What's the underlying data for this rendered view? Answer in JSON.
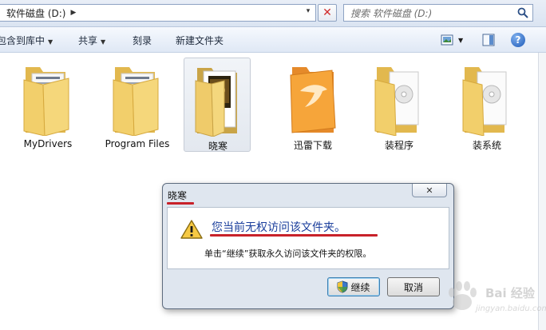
{
  "address_bar": {
    "path_label": "软件磁盘 (D:)",
    "separator": "▶",
    "dropdown_glyph": "▾",
    "stop_glyph": "✕",
    "search_placeholder": "搜索 软件磁盘 (D:)"
  },
  "command_bar": {
    "include_library_label": "包含到库中",
    "share_label": "共享",
    "burn_label": "刻录",
    "new_folder_label": "新建文件夹",
    "help_glyph": "?"
  },
  "files": [
    {
      "label": "MyDrivers",
      "icon": "folder-documents-icon"
    },
    {
      "label": "Program Files",
      "icon": "folder-documents-icon"
    },
    {
      "label": "晓寒",
      "icon": "folder-media-icon",
      "selected": true
    },
    {
      "label": "迅雷下载",
      "icon": "folder-thunder-icon"
    },
    {
      "label": "装程序",
      "icon": "folder-disc-icon"
    },
    {
      "label": "装系统",
      "icon": "folder-disc-icon"
    }
  ],
  "dialog": {
    "title": "晓寒",
    "close_glyph": "✕",
    "message": "您当前无权访问该文件夹。",
    "detail": "单击“继续”获取永久访问该文件夹的权限。",
    "continue_label": "继续",
    "cancel_label": "取消"
  },
  "watermark": {
    "text": "Bai 经验",
    "sub": "jingyan.baidu.com"
  },
  "colors": {
    "accent_underline": "#c8222a",
    "message_text": "#1a3e9c",
    "folder_yellow": "#f2cf6b"
  }
}
